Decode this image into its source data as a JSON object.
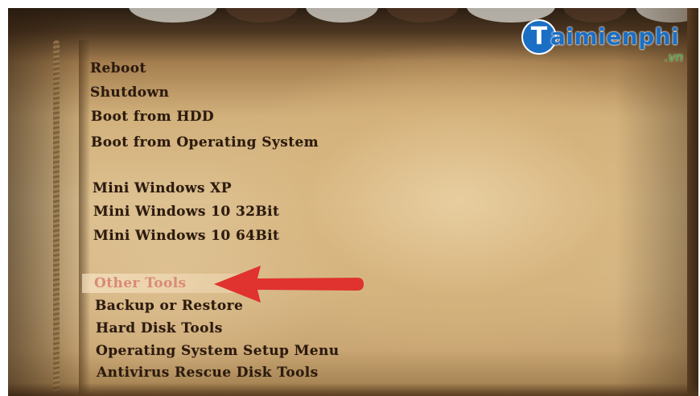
{
  "logo": {
    "mark": "T",
    "name": "aimienphi",
    "suffix": ".vn"
  },
  "menu": {
    "items": [
      {
        "label": "Reboot"
      },
      {
        "label": "Shutdown"
      },
      {
        "label": "Boot from HDD"
      },
      {
        "label": "Boot from Operating System"
      },
      {
        "label": "Mini Windows XP"
      },
      {
        "label": "Mini Windows 10 32Bit"
      },
      {
        "label": "Mini Windows 10 64Bit"
      },
      {
        "label": "Other Tools",
        "selected": true
      },
      {
        "label": "Backup or Restore"
      },
      {
        "label": "Hard Disk Tools"
      },
      {
        "label": "Operating System Setup Menu"
      },
      {
        "label": "Antivirus Rescue Disk Tools"
      }
    ]
  },
  "colors": {
    "menu_text": "#2b1a0e",
    "selected_text": "#d98a78",
    "arrow": "#e0322e",
    "logo_blue": "#1a6fc4",
    "logo_green": "#3aa839"
  },
  "icons": {
    "annotation": "red-arrow-icon"
  }
}
